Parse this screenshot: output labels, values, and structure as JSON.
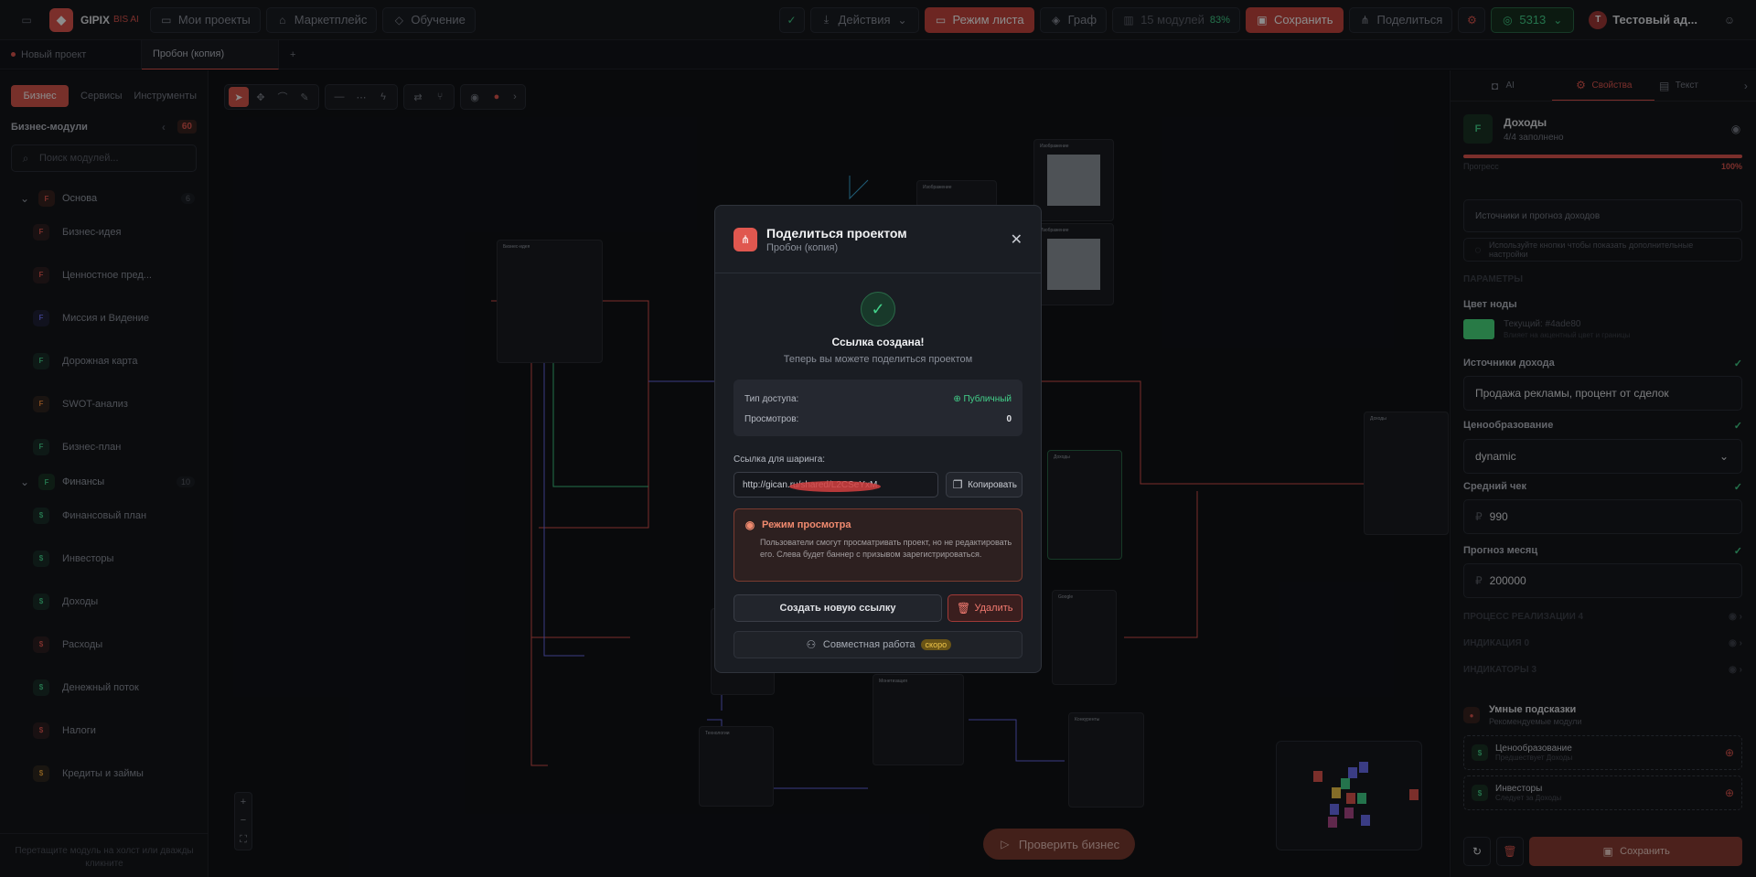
{
  "topbar": {
    "brand": "GIPIX",
    "brand_sub": "BIS AI",
    "my_projects": "Мои проекты",
    "marketplace": "Маркетплейс",
    "learning": "Обучение",
    "actions": "Действия",
    "sheet_mode": "Режим листа",
    "graph": "Граф",
    "modules": "15 модулей",
    "modules_pct": "83%",
    "save": "Сохранить",
    "share": "Поделиться",
    "balance": "5313",
    "user_initial": "Т",
    "user_name": "Тестовый ад..."
  },
  "tabs": {
    "new_project": "Новый проект",
    "current": "Пробон (копия)",
    "add": "+"
  },
  "sidebar": {
    "seg": [
      "Бизнес",
      "Сервисы",
      "Инструменты"
    ],
    "title": "Бизнес-модули",
    "count": "60",
    "search_placeholder": "Поиск модулей...",
    "group1": {
      "letter": "F",
      "name": "Основа",
      "count": "6"
    },
    "group2": {
      "letter": "F",
      "name": "Финансы",
      "count": "10"
    },
    "items1": [
      {
        "letter": "F",
        "label": "Бизнес-идея",
        "color": "#e0574f"
      },
      {
        "letter": "F",
        "label": "Ценностное пред...",
        "color": "#e0574f"
      },
      {
        "letter": "F",
        "label": "Миссия и Видение",
        "color": "#6a6ef0"
      },
      {
        "letter": "F",
        "label": "Дорожная карта",
        "color": "#43d18a"
      },
      {
        "letter": "F",
        "label": "SWOT-анализ",
        "color": "#f08a3a"
      },
      {
        "letter": "F",
        "label": "Бизнес-план",
        "color": "#43d18a"
      }
    ],
    "items2": [
      {
        "letter": "$",
        "label": "Финансовый план",
        "color": "#43d18a"
      },
      {
        "letter": "$",
        "label": "Инвесторы",
        "color": "#43d18a"
      },
      {
        "letter": "$",
        "label": "Доходы",
        "color": "#43d18a"
      },
      {
        "letter": "$",
        "label": "Расходы",
        "color": "#e0574f"
      },
      {
        "letter": "$",
        "label": "Денежный поток",
        "color": "#43d18a"
      },
      {
        "letter": "$",
        "label": "Налоги",
        "color": "#e0574f"
      },
      {
        "letter": "$",
        "label": "Кредиты и займы",
        "color": "#f0a83a"
      }
    ],
    "footer": "Перетащите модуль на холст или дважды кликните"
  },
  "canvas": {
    "check_button": "Проверить бизнес",
    "node_title": "Бизнес-идея",
    "income_node": "Доходы",
    "google_node": "Google",
    "income_node2": "Монетизация",
    "competitors_node": "Конкуренты",
    "tech_node": "Технологии",
    "image_node": "Изображение"
  },
  "modal": {
    "title": "Поделиться проектом",
    "subtitle": "Пробон (копия)",
    "success_title": "Ссылка создана!",
    "success_sub": "Теперь вы можете поделиться проектом",
    "access_label": "Тип доступа:",
    "access_value": "Публичный",
    "views_label": "Просмотров:",
    "views_value": "0",
    "link_label": "Ссылка для шаринга:",
    "link_value": "http://gican.ru/shared/L2CSeYxM",
    "copy": "Копировать",
    "view_mode_title": "Режим просмотра",
    "view_mode_desc": "Пользователи смогут просматривать проект, но не редактировать его. Слева будет баннер с призывом зарегистрироваться.",
    "new_link": "Создать новую ссылку",
    "delete": "Удалить",
    "collab": "Совместная работа",
    "soon": "скоро"
  },
  "rpanel": {
    "tabs": [
      "AI",
      "Свойства",
      "Текст"
    ],
    "node_letter": "F",
    "node_title": "Доходы",
    "node_sub": "4/4 заполнено",
    "progress_label": "Прогресс",
    "progress_pct": "100%",
    "progress_value": 1.0,
    "description_placeholder": "Источники и прогноз доходов",
    "hint": "Используйте кнопки  чтобы показать дополнительные настройки",
    "params": "ПАРАМЕТРЫ",
    "color_label": "Цвет ноды",
    "color_current": "Текущий: #4ade80",
    "color_hint": "Влияет на акцентный цвет и границы",
    "color_hex": "#4ade80",
    "sources_label": "Источники дохода",
    "sources_value": "Продажа рекламы, процент от сделок",
    "pricing_label": "Ценообразование",
    "pricing_value": "dynamic",
    "avg_label": "Средний чек",
    "avg_value": "990",
    "forecast_label": "Прогноз месяц",
    "forecast_value": "200000",
    "currency": "₽",
    "sec1": "ПРОЦЕСС РЕАЛИЗАЦИИ",
    "sec1_count": "4",
    "sec2": "ИНДИКАЦИЯ",
    "sec2_count": "0",
    "sec3": "ИНДИКАТОРЫ",
    "sec3_count": "3",
    "smart_title": "Умные подсказки",
    "smart_sub": "Рекомендуемые модули",
    "sugg1_title": "Ценообразование",
    "sugg1_sub": "Предшествует Доходы",
    "sugg2_title": "Инвесторы",
    "sugg2_sub": "Следует за Доходы",
    "save": "Сохранить"
  }
}
